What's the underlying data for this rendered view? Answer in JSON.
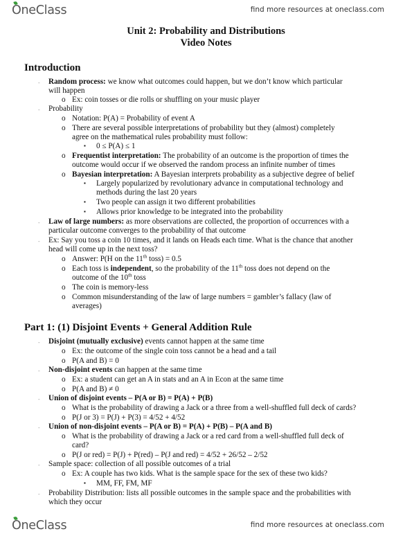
{
  "header": {
    "logo_text_o": "O",
    "logo_text_rest": "neClass",
    "tagline": "find more resources at oneclass.com"
  },
  "footer": {
    "logo_text_o": "O",
    "logo_text_rest": "neClass",
    "tagline": "find more resources at oneclass.com"
  },
  "document": {
    "title": "Unit 2: Probability and Distributions",
    "subtitle": "Video Notes",
    "sections": [
      {
        "heading": "Introduction"
      },
      {
        "heading": "Part 1: (1) Disjoint Events + General Addition Rule"
      }
    ],
    "lines": {
      "l1_bold": "Random process:",
      "l1_text": " we know what outcomes could happen, but we don’t know which particular",
      "l2": "will happen",
      "l3": "Ex: coin tosses or die rolls or shuffling on your music player",
      "l4": "Probability",
      "l5": "Notation: P(A) = Probability of event A",
      "l6": "There are several possible interpretations of probability but they (almost) completely",
      "l7": "agree on the mathematical rules probability must follow:",
      "l8": "0 ≤ P(A) ≤ 1",
      "l9_bold": "Frequentist interpretation:",
      "l9_text": " The probability of an outcome is the proportion of times the",
      "l10": "outcome would occur if we observed the random process an infinite number of times",
      "l11_bold": "Bayesian interpretation:",
      "l11_text": " A Bayesian interprets probability as a subjective degree of belief",
      "l12": "Largely popularized by revolutionary advance in computational technology and",
      "l13": "methods during the last 20 years",
      "l14": "Two people can assign it two different probabilities",
      "l15": "Allows prior knowledge to be integrated into the probability",
      "l16_bold": "Law of large numbers:",
      "l16_text": " as more observations are collected, the proportion of occurrences with a",
      "l17": "particular outcome converges to the probability of that outcome",
      "l18": "Ex: Say you toss a coin 10 times, and it lands on Heads each time. What is the chance that another",
      "l19": "head will come up in the next toss?",
      "l20a": "Answer: P(H on the 11",
      "l20sup": "th",
      "l20b": " toss) = 0.5",
      "l21a": "Each toss is ",
      "l21bold": "independent",
      "l21b": ", so the probability of the 11",
      "l21sup": "th",
      "l21c": " toss does not depend on the",
      "l22a": "outcome of the 10",
      "l22sup": "th",
      "l22b": " toss",
      "l23": "The coin is memory-less",
      "l24": "Common misunderstanding of the law of large numbers = gambler’s fallacy (law of",
      "l25": "averages)",
      "p1_bold": "Disjoint (mutually exclusive)",
      "p1_text": " events cannot happen at the same time",
      "p2": "Ex: the outcome of the single coin toss cannot be a head and a tail",
      "p3": "P(A and B) = 0",
      "p4_bold": "Non-disjoint events",
      "p4_text": " can happen at the same time",
      "p5": "Ex: a student can get an A in stats and an A in Econ at the same time",
      "p6": "P(A and B) ≠ 0",
      "p7_bold": "Union of disjoint events – P(A or B) = P(A) + P(B)",
      "p8": "What is the probability of drawing a Jack or a three from a well-shuffled full deck of cards?",
      "p9": "P(J or 3) = P(J) + P(3) = 4/52 + 4/52",
      "p10_bold": "Union of non-disjoint events – P(A or B) = P(A) + P(B) – P(A and B)",
      "p11": "What is the probability of drawing a Jack or a red card from a well-shuffled full deck of",
      "p12": "card?",
      "p13": "P(J or red) = P(J) + P(red) – P(J and red) = 4/52 + 26/52 – 2/52",
      "p14": "Sample space: collection of all possible outcomes of a trial",
      "p15": "Ex: A couple has two kids. What is the sample space for the sex of these two kids?",
      "p16": "MM, FF, FM, MF",
      "p17": "Probability Distribution: lists all possible outcomes in the sample space and the probabilities with",
      "p18": "which they occur"
    },
    "markers": {
      "dash": "-",
      "circle": "o",
      "square": "▪"
    }
  }
}
